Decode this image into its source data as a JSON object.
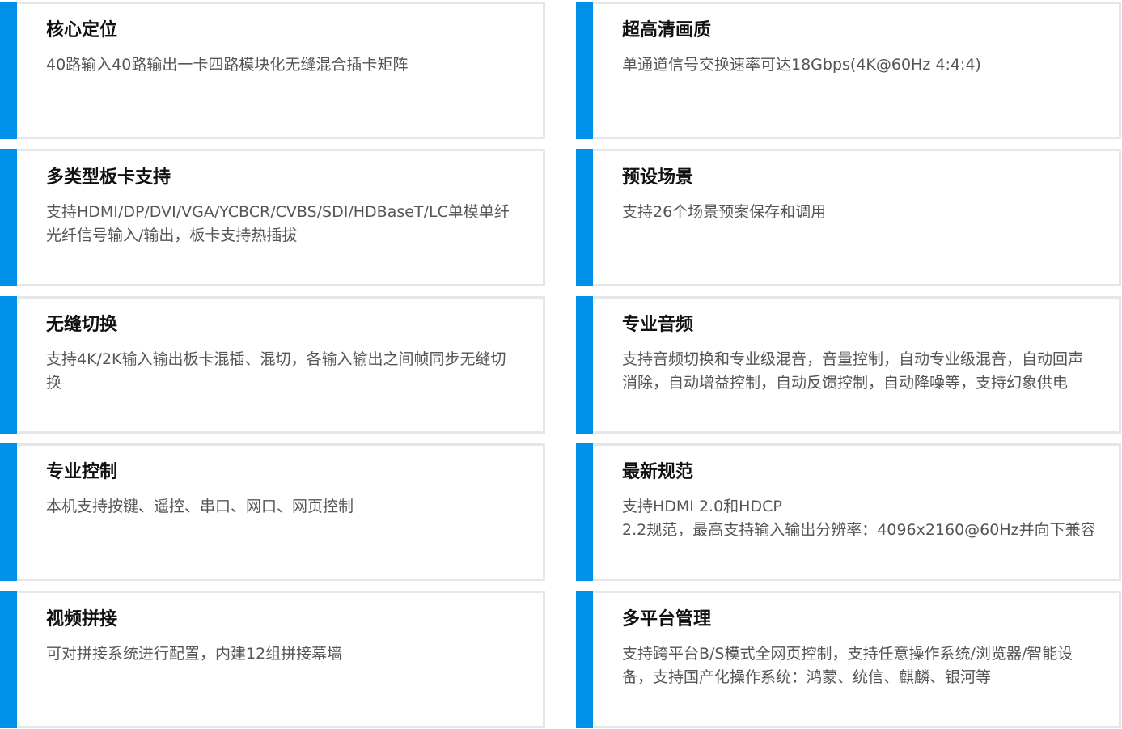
{
  "features": [
    {
      "title": "核心定位",
      "desc": "40路输入40路输出一卡四路模块化无缝混合插卡矩阵"
    },
    {
      "title": "超高清画质",
      "desc": "单通道信号交换速率可达18Gbps(4K@60Hz 4:4:4)"
    },
    {
      "title": "多类型板卡支持",
      "desc": "支持HDMI/DP/DVI/VGA/YCBCR/CVBS/SDI/HDBaseT/LC单模单纤光纤信号输入/输出，板卡支持热插拔"
    },
    {
      "title": "预设场景",
      "desc": "支持26个场景预案保存和调用"
    },
    {
      "title": "无缝切换",
      "desc": "支持4K/2K输入输出板卡混插、混切，各输入输出之间帧同步无缝切换"
    },
    {
      "title": "专业音频",
      "desc": "支持音频切换和专业级混音，音量控制，自动专业级混音，自动回声消除，自动增益控制，自动反馈控制，自动降噪等，支持幻象供电"
    },
    {
      "title": "专业控制",
      "desc": "本机支持按键、遥控、串口、网口、网页控制"
    },
    {
      "title": "最新规范",
      "desc": "支持HDMI 2.0和HDCP\n2.2规范，最高支持输入输出分辨率：4096x2160@60Hz并向下兼容"
    },
    {
      "title": "视频拼接",
      "desc": "可对拼接系统进行配置，内建12组拼接幕墙"
    },
    {
      "title": "多平台管理",
      "desc": "支持跨平台B/S模式全网页控制，支持任意操作系统/浏览器/智能设备，支持国产化操作系统：鸿蒙、统信、麒麟、银河等"
    }
  ],
  "colors": {
    "accent": "#0091ea",
    "border": "#e3e6ea",
    "title": "#111111",
    "text": "#555555"
  }
}
